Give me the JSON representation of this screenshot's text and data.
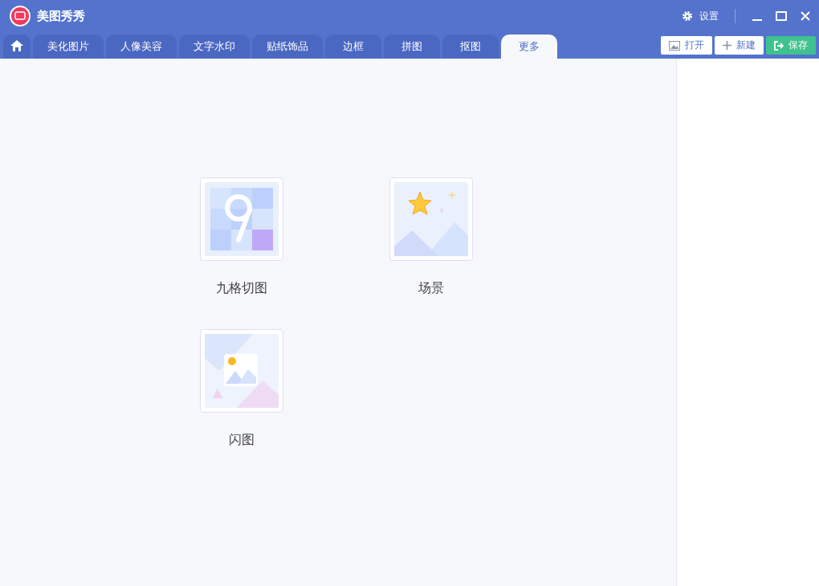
{
  "window": {
    "title": "美图秀秀",
    "settings": "设置"
  },
  "tabs": [
    {
      "label": "美化图片",
      "selected": false
    },
    {
      "label": "人像美容",
      "selected": false
    },
    {
      "label": "文字水印",
      "selected": false
    },
    {
      "label": "贴纸饰品",
      "selected": false
    },
    {
      "label": "边框",
      "selected": false
    },
    {
      "label": "拼图",
      "selected": false
    },
    {
      "label": "抠图",
      "selected": false
    },
    {
      "label": "更多",
      "selected": true
    }
  ],
  "actions": [
    {
      "kind": "open",
      "label": "打开"
    },
    {
      "kind": "new",
      "label": "新建"
    },
    {
      "kind": "save",
      "label": "保存"
    }
  ],
  "tools": [
    {
      "kind": "grid",
      "label": "九格切图"
    },
    {
      "kind": "scene",
      "label": "场景"
    },
    {
      "kind": "flash",
      "label": "闪图"
    }
  ]
}
